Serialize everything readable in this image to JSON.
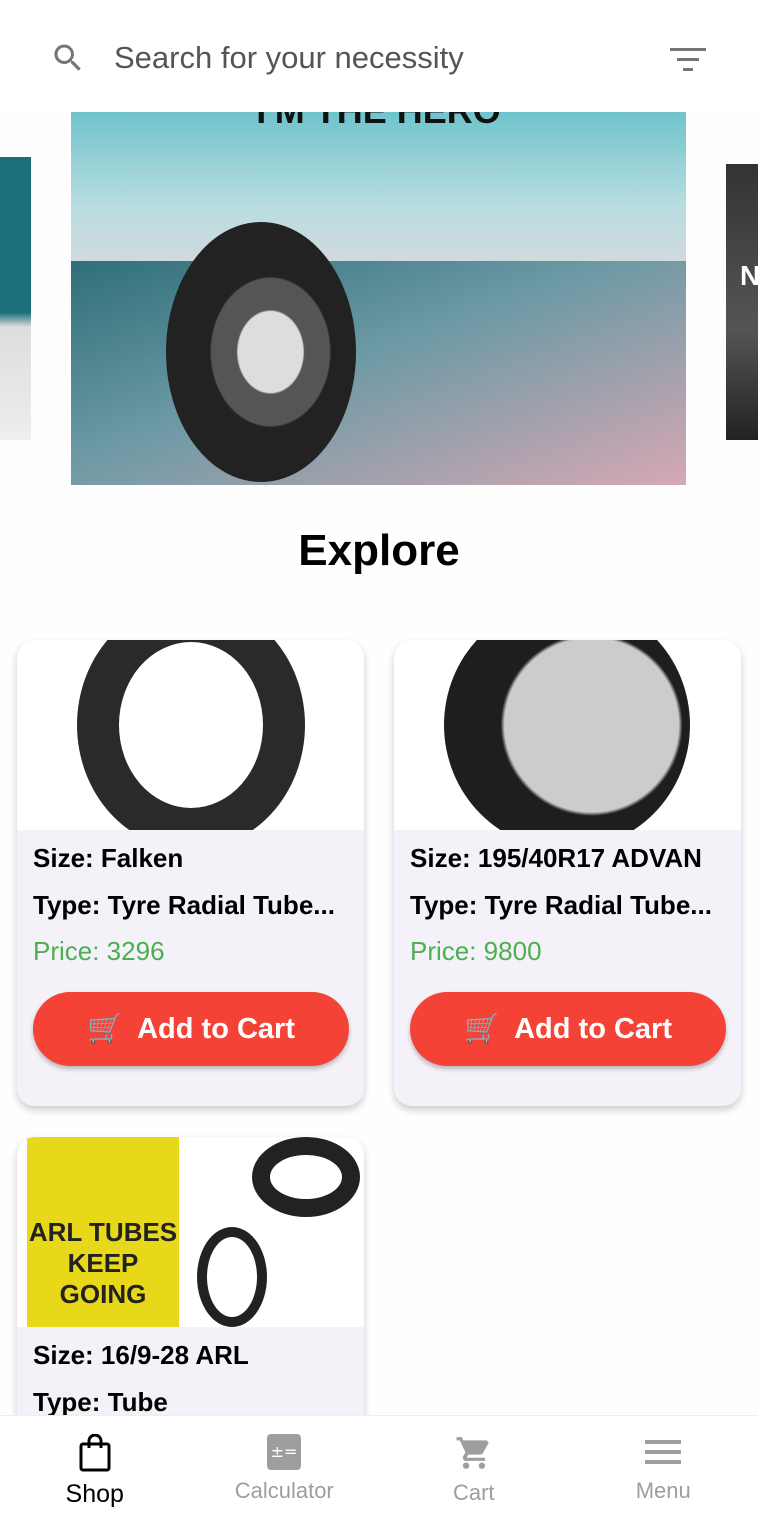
{
  "search": {
    "placeholder": "Search for your necessity",
    "icon": "search-icon",
    "filter_icon": "filter-icon"
  },
  "banner": {
    "text": "I'M THE HERO",
    "right_peek_text": "N"
  },
  "section_title": "Explore",
  "products": [
    {
      "size": "Size: Falken",
      "type": "Type: Tyre Radial Tube...",
      "price": "Price: 3296",
      "button": "Add to Cart"
    },
    {
      "size": "Size: 195/40R17 ADVAN",
      "type": "Type: Tyre Radial Tube...",
      "price": "Price: 9800",
      "button": "Add to Cart"
    },
    {
      "size": "Size: 16/9-28 ARL",
      "type": "Type: Tube",
      "image_text": "ARL TUBES KEEP GOING"
    }
  ],
  "nav": [
    {
      "label": "Shop",
      "icon": "shopping-bag-icon",
      "active": true
    },
    {
      "label": "Calculator",
      "icon": "calculator-icon"
    },
    {
      "label": "Cart",
      "icon": "cart-icon"
    },
    {
      "label": "Menu",
      "icon": "menu-icon"
    }
  ],
  "colors": {
    "accent": "#f44336",
    "price": "#4caf50",
    "card_bg": "#f4f2f8"
  }
}
